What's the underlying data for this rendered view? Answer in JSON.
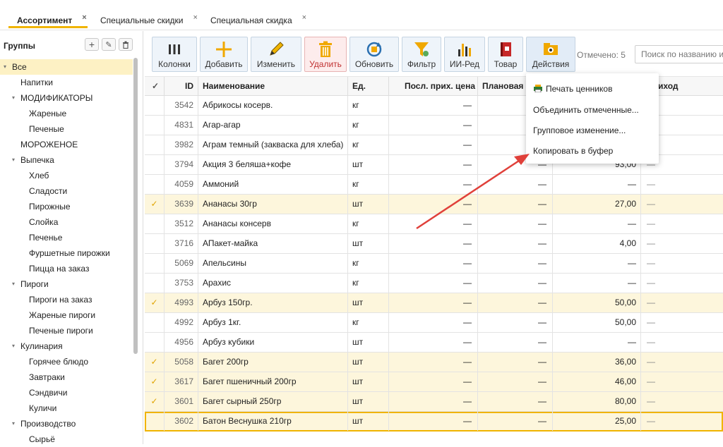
{
  "tabs": [
    {
      "label": "Ассортимент",
      "close": "×"
    },
    {
      "label": "Специальные скидки",
      "close": "×"
    },
    {
      "label": "Специальная скидка",
      "close": "×"
    }
  ],
  "groups": {
    "title": "Группы",
    "buttons": {
      "add": "+",
      "edit": "✎",
      "delete": "🗑"
    },
    "tree": [
      {
        "label": "Все",
        "level": 0,
        "expanded": true,
        "selected": true
      },
      {
        "label": "Напитки",
        "level": 1
      },
      {
        "label": "МОДИФИКАТОРЫ",
        "level": 1,
        "expanded": true
      },
      {
        "label": "Жареные",
        "level": 2
      },
      {
        "label": "Печеные",
        "level": 2
      },
      {
        "label": "МОРОЖЕНОЕ",
        "level": 1
      },
      {
        "label": "Выпечка",
        "level": 1,
        "expanded": true
      },
      {
        "label": "Хлеб",
        "level": 2
      },
      {
        "label": "Сладости",
        "level": 2
      },
      {
        "label": "Пирожные",
        "level": 2
      },
      {
        "label": "Слойка",
        "level": 2
      },
      {
        "label": "Печенье",
        "level": 2
      },
      {
        "label": "Фуршетные пирожки",
        "level": 2
      },
      {
        "label": "Пицца на заказ",
        "level": 2
      },
      {
        "label": "Пироги",
        "level": 1,
        "expanded": true
      },
      {
        "label": "Пироги на заказ",
        "level": 2
      },
      {
        "label": "Жареные пироги",
        "level": 2
      },
      {
        "label": "Печеные пироги",
        "level": 2
      },
      {
        "label": "Кулинария",
        "level": 1,
        "expanded": true
      },
      {
        "label": "Горячее блюдо",
        "level": 2
      },
      {
        "label": "Завтраки",
        "level": 2
      },
      {
        "label": "Сэндвичи",
        "level": 2
      },
      {
        "label": "Куличи",
        "level": 2
      },
      {
        "label": "Производство",
        "level": 1,
        "expanded": true
      },
      {
        "label": "Сырьё",
        "level": 2
      }
    ]
  },
  "toolbar": {
    "buttons": [
      {
        "label": "Колонки",
        "icon": "columns-icon"
      },
      {
        "label": "Добавить",
        "icon": "plus-icon"
      },
      {
        "label": "Изменить",
        "icon": "pencil-icon"
      },
      {
        "label": "Удалить",
        "icon": "trash-icon"
      },
      {
        "label": "Обновить",
        "icon": "refresh-icon"
      },
      {
        "label": "Фильтр",
        "icon": "filter-icon"
      },
      {
        "label": "ИИ-Ред",
        "icon": "bar-chart-icon"
      },
      {
        "label": "Товар",
        "icon": "product-book-icon"
      },
      {
        "label": "Действия",
        "icon": "actions-icon"
      }
    ],
    "marked": "Отмечено: 5",
    "search_placeholder": "Поиск по названию и"
  },
  "table": {
    "headers": {
      "check": "✓",
      "id": "ID",
      "name": "Наименование",
      "unit": "Ед.",
      "last": "Посл. прих. цена",
      "plan": "Плановая",
      "price": "",
      "income": "Приход"
    },
    "rows": [
      {
        "mark": "",
        "id": "3542",
        "name": "Абрикосы косерв.",
        "unit": "кг",
        "last": "—",
        "plan": "—",
        "price": "—",
        "income": "—"
      },
      {
        "mark": "",
        "id": "4831",
        "name": "Агар-агар",
        "unit": "кг",
        "last": "—",
        "plan": "—",
        "price": "—",
        "income": "—"
      },
      {
        "mark": "",
        "id": "3982",
        "name": "Аграм темный (закваска для хлеба)",
        "unit": "кг",
        "last": "—",
        "plan": "—",
        "price": "—",
        "income": "—"
      },
      {
        "mark": "",
        "id": "3794",
        "name": "Акция 3 беляша+кофе",
        "unit": "шт",
        "last": "—",
        "plan": "—",
        "price": "93,00",
        "income": "—"
      },
      {
        "mark": "",
        "id": "4059",
        "name": "Аммоний",
        "unit": "кг",
        "last": "—",
        "plan": "—",
        "price": "—",
        "income": "—"
      },
      {
        "mark": "✓",
        "id": "3639",
        "name": "Ананасы 30гр",
        "unit": "шт",
        "last": "—",
        "plan": "—",
        "price": "27,00",
        "income": "—"
      },
      {
        "mark": "",
        "id": "3512",
        "name": "Ананасы консерв",
        "unit": "кг",
        "last": "—",
        "plan": "—",
        "price": "—",
        "income": "—"
      },
      {
        "mark": "",
        "id": "3716",
        "name": "АПакет-майка",
        "unit": "шт",
        "last": "—",
        "plan": "—",
        "price": "4,00",
        "income": "—"
      },
      {
        "mark": "",
        "id": "5069",
        "name": "Апельсины",
        "unit": "кг",
        "last": "—",
        "plan": "—",
        "price": "—",
        "income": "—"
      },
      {
        "mark": "",
        "id": "3753",
        "name": "Арахис",
        "unit": "кг",
        "last": "—",
        "plan": "—",
        "price": "—",
        "income": "—"
      },
      {
        "mark": "✓",
        "id": "4993",
        "name": "Арбуз 150гр.",
        "unit": "шт",
        "last": "—",
        "plan": "—",
        "price": "50,00",
        "income": "—"
      },
      {
        "mark": "",
        "id": "4992",
        "name": "Арбуз 1кг.",
        "unit": "кг",
        "last": "—",
        "plan": "—",
        "price": "50,00",
        "income": "—"
      },
      {
        "mark": "",
        "id": "4956",
        "name": "Арбуз кубики",
        "unit": "шт",
        "last": "—",
        "plan": "—",
        "price": "—",
        "income": "—"
      },
      {
        "mark": "✓",
        "id": "5058",
        "name": "Багет 200гр",
        "unit": "шт",
        "last": "—",
        "plan": "—",
        "price": "36,00",
        "income": "—"
      },
      {
        "mark": "✓",
        "id": "3617",
        "name": "Багет пшеничный 200гр",
        "unit": "шт",
        "last": "—",
        "plan": "—",
        "price": "46,00",
        "income": "—"
      },
      {
        "mark": "✓",
        "id": "3601",
        "name": "Багет сырный 250гр",
        "unit": "шт",
        "last": "—",
        "plan": "—",
        "price": "80,00",
        "income": "—"
      },
      {
        "mark": "",
        "id": "3602",
        "name": "Батон Веснушка 210гр",
        "unit": "шт",
        "last": "—",
        "plan": "—",
        "price": "25,00",
        "income": "—",
        "current": true
      }
    ]
  },
  "menu": {
    "items": [
      {
        "label": "Печать ценников",
        "icon": "printer-icon"
      },
      {
        "label": "Объединить отмеченные..."
      },
      {
        "label": "Групповое изменение..."
      },
      {
        "label": "Копировать в буфер"
      }
    ]
  },
  "colors": {
    "accent": "#f0b400",
    "marked_row": "#fdf6dc",
    "arrow": "#e0403a",
    "toolbar_bg": "#eef4fa"
  }
}
